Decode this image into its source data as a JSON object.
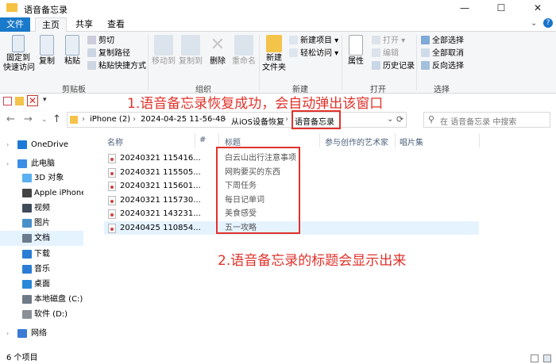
{
  "window": {
    "title": "语音备忘录",
    "controls": [
      "—",
      "☐",
      "✕"
    ]
  },
  "tabs": [
    {
      "label": "文件"
    },
    {
      "label": "主页"
    },
    {
      "label": "共享"
    },
    {
      "label": "查看"
    }
  ],
  "ribbon": {
    "clipboard": {
      "pin_label": "固定到\n快速访问",
      "copy_label": "复制",
      "paste_label": "粘贴",
      "cut_label": "剪切",
      "copy_path_label": "复制路径",
      "paste_shortcut_label": "粘贴快捷方式",
      "group_title": "剪贴板"
    },
    "organize": {
      "move_to_label": "移动到",
      "copy_to_label": "复制到",
      "delete_label": "删除",
      "rename_label": "重命名",
      "group_title": "组织"
    },
    "new": {
      "new_folder_label": "新建\n文件夹",
      "new_item_label": "新建项目",
      "easy_access_label": "轻松访问",
      "group_title": "新建"
    },
    "open": {
      "properties_label": "属性",
      "open_label": "打开",
      "edit_label": "编辑",
      "history_label": "历史记录",
      "group_title": "打开"
    },
    "select": {
      "select_all_label": "全部选择",
      "select_none_label": "全部取消",
      "invert_label": "反向选择",
      "group_title": "选择"
    }
  },
  "address": {
    "crumbs": [
      "iPhone (2)",
      "2024-04-25 11-56-48",
      "从iOS设备恢复",
      "语音备忘录"
    ],
    "search_placeholder": "在 语音备忘录 中搜索"
  },
  "nav_items": [
    {
      "label": "OneDrive",
      "color": "#1c7ad6"
    },
    {
      "label": "此电脑",
      "color": "#3a8ee6"
    },
    {
      "label": "3D 对象",
      "color": "#5ab0f0"
    },
    {
      "label": "Apple iPhone",
      "color": "#444444"
    },
    {
      "label": "视频",
      "color": "#3f4a5a"
    },
    {
      "label": "图片",
      "color": "#4a90c8"
    },
    {
      "label": "文档",
      "color": "#6a7c8e"
    },
    {
      "label": "下载",
      "color": "#2a7dd4"
    },
    {
      "label": "音乐",
      "color": "#2a7dd4"
    },
    {
      "label": "桌面",
      "color": "#2a88d8"
    },
    {
      "label": "本地磁盘 (C:)",
      "color": "#707a86"
    },
    {
      "label": "软件 (D:)",
      "color": "#8a8f96"
    },
    {
      "label": "网络",
      "color": "#3a7bd5"
    }
  ],
  "columns": {
    "name": "名称",
    "num": "#",
    "title": "标题",
    "artist": "参与创作的艺术家",
    "album": "唱片集"
  },
  "files": [
    {
      "name": "20240321 115416...",
      "title": "白云山出行注意事项"
    },
    {
      "name": "20240321 115505...",
      "title": "网购要买的东西"
    },
    {
      "name": "20240321 115601...",
      "title": "下周任务"
    },
    {
      "name": "20240321 115730...",
      "title": "每日记单词"
    },
    {
      "name": "20240321 143231...",
      "title": "美食感受"
    },
    {
      "name": "20240425 110854...",
      "title": "五一攻略"
    }
  ],
  "annotations": {
    "note1": "1.语音备忘录恢复成功，会自动弹出该窗口",
    "note2": "2.语音备忘录的标题会显示出来",
    "color": "#e0322b"
  },
  "status": {
    "count": "6 个项目"
  }
}
